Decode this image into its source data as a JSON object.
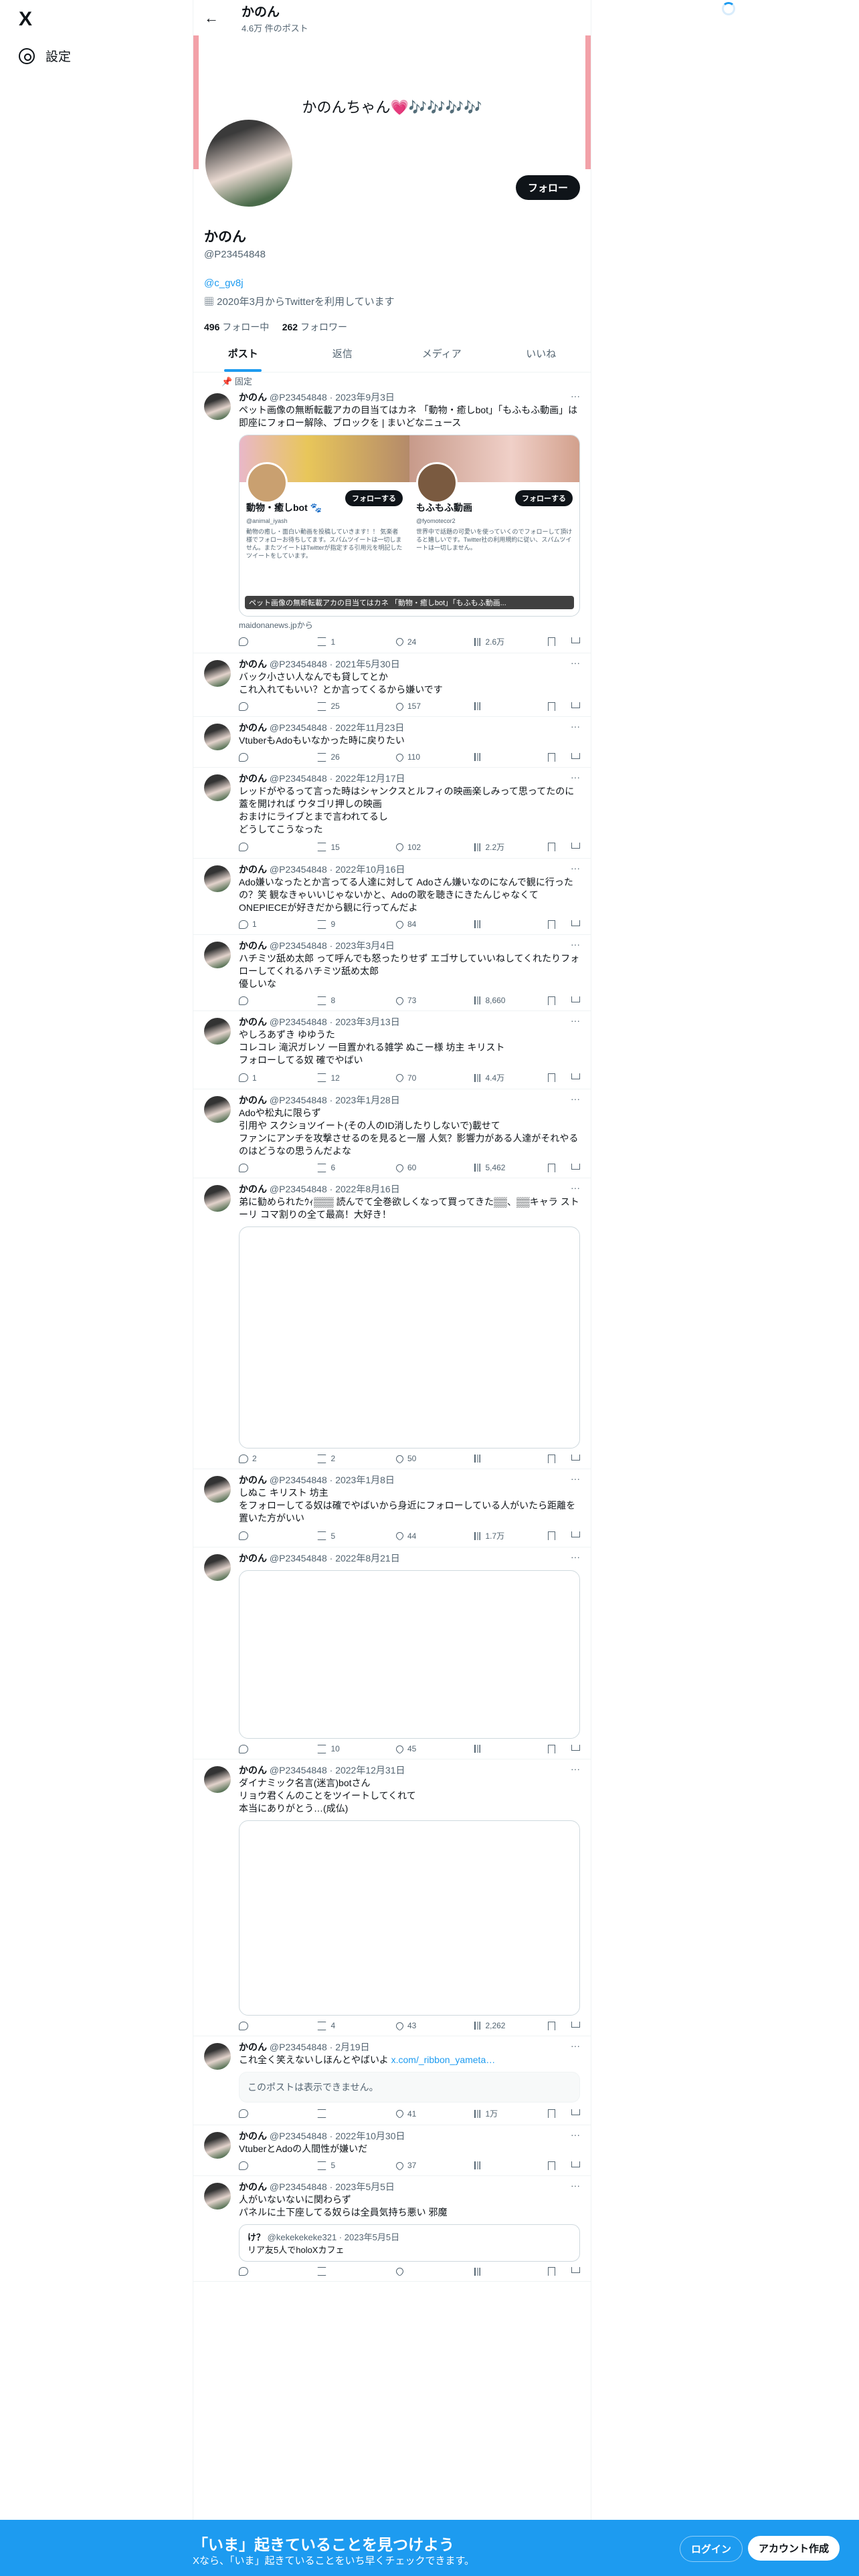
{
  "nav": {
    "logo": "X",
    "settings_label": "設定"
  },
  "header": {
    "name": "かのん",
    "post_count": "4.6万 件のポスト"
  },
  "profile": {
    "banner_text": "かのんちゃん💗🎶🎶🎶🎶",
    "follow_button": "フォロー",
    "name": "かのん",
    "handle": "@P23454848",
    "link": "@c_gv8j",
    "joined": "2020年3月からTwitterを利用しています",
    "following_count": "496",
    "following_label": "フォロー中",
    "followers_count": "262",
    "followers_label": "フォロワー"
  },
  "tabs": [
    "ポスト",
    "返信",
    "メディア",
    "いいね"
  ],
  "pinned_label": "固定",
  "tweets": [
    {
      "name": "かのん",
      "handle": "@P23454848",
      "date": "2023年9月3日",
      "text": "ペット画像の無断転載アカの目当てはカネ 「動物・癒しbot」「もふもふ動画」は即座にフォロー解除、ブロックを | まいどなニュース",
      "card": {
        "left_name": "動物・癒しbot 🐾",
        "left_handle": "@animal_iyash",
        "left_desc": "動物の癒し・面白い動画を投稿していきます！！ 気楽者様でフォローお待ちしてます。スパムツイートは一切しません。またツイートはTwitterが指定する引用元を明記したツイートをしています。",
        "right_name": "もふもふ動画",
        "right_handle": "@fyomotecor2",
        "right_desc": "世界中で話題の可愛いを使っていくのでフォローして頂けると嬉しいです。Twitter社の利用規約に従い、スパムツイートは一切しません。",
        "follow": "フォローする",
        "caption": "ペット画像の無断転載アカの目当てはカネ 「動物・癒しbot」「もふもふ動画...",
        "source": "maidonanews.jpから"
      },
      "reply": "",
      "rt": "1",
      "like": "24",
      "views": "2.6万"
    },
    {
      "name": "かのん",
      "handle": "@P23454848",
      "date": "2021年5月30日",
      "text": "バック小さい人なんでも貸してとか\nこれ入れてもいい？とか言ってくるから嫌いです",
      "reply": "",
      "rt": "25",
      "like": "157",
      "views": ""
    },
    {
      "name": "かのん",
      "handle": "@P23454848",
      "date": "2022年11月23日",
      "text": "VtuberもAdoもいなかった時に戻りたい",
      "reply": "",
      "rt": "26",
      "like": "110",
      "views": ""
    },
    {
      "name": "かのん",
      "handle": "@P23454848",
      "date": "2022年12月17日",
      "text": "レッドがやるって言った時はシャンクスとルフィの映画楽しみって思ってたのに\n蓋を開ければ ウタゴリ押しの映画\nおまけにライブとまで言われてるし\nどうしてこうなった",
      "reply": "",
      "rt": "15",
      "like": "102",
      "views": "2.2万"
    },
    {
      "name": "かのん",
      "handle": "@P23454848",
      "date": "2022年10月16日",
      "text": "Ado嫌いなったとか言ってる人達に対して Adoさん嫌いなのになんで観に行ったの？笑 観なきゃいいじゃないかと、Adoの歌を聴きにきたんじゃなくてONEPIECEが好きだから観に行ってんだよ",
      "reply": "1",
      "rt": "9",
      "like": "84",
      "views": ""
    },
    {
      "name": "かのん",
      "handle": "@P23454848",
      "date": "2023年3月4日",
      "text": "ハチミツ舐め太郎 って呼んでも怒ったりせず エゴサしていいねしてくれたりフォローしてくれるハチミツ舐め太郎\n優しいな",
      "reply": "",
      "rt": "8",
      "like": "73",
      "views": "8,660"
    },
    {
      "name": "かのん",
      "handle": "@P23454848",
      "date": "2023年3月13日",
      "text": "やしろあずき ゆゆうた\nコレコレ 滝沢ガレソ 一目置かれる雑学 ぬこー様 坊主 キリスト\nフォローしてる奴 確でやばい",
      "reply": "1",
      "rt": "12",
      "like": "70",
      "views": "4.4万"
    },
    {
      "name": "かのん",
      "handle": "@P23454848",
      "date": "2023年1月28日",
      "text": "Adoや松丸に限らず\n引用や スクショツイート(その人のID消したりしないで)載せて\nファンにアンチを攻撃させるのを見ると一層 人気？影響力がある人達がそれやるのはどうなの思うんだよな",
      "reply": "",
      "rt": "6",
      "like": "60",
      "views": "5,462"
    },
    {
      "name": "かのん",
      "handle": "@P23454848",
      "date": "2022年8月16日",
      "text": "弟に勧められたｳｨ▒▒▒ 読んでて全巻欲しくなって買ってきた▒▒、▒▒キャラ ストーリ コマ割りの全て最高！大好き！",
      "media": 330,
      "reply": "2",
      "rt": "2",
      "like": "50",
      "views": ""
    },
    {
      "name": "かのん",
      "handle": "@P23454848",
      "date": "2023年1月8日",
      "text": "しぬこ キリスト 坊主\nをフォローしてる奴は確でやばいから身近にフォローしている人がいたら距離を置いた方がいい",
      "reply": "",
      "rt": "5",
      "like": "44",
      "views": "1.7万"
    },
    {
      "name": "かのん",
      "handle": "@P23454848",
      "date": "2022年8月21日",
      "text": "",
      "media": 250,
      "reply": "",
      "rt": "10",
      "like": "45",
      "views": ""
    },
    {
      "name": "かのん",
      "handle": "@P23454848",
      "date": "2022年12月31日",
      "text": "ダイナミック名言(迷言)botさん\nリョウ君くんのことをツイートしてくれて\n本当にありがとう…(成仏)",
      "media": 290,
      "reply": "",
      "rt": "4",
      "like": "43",
      "views": "2,262"
    },
    {
      "name": "かのん",
      "handle": "@P23454848",
      "date": "2月19日",
      "text": "これ全く笑えないしほんとやばいよ ",
      "link": "x.com/_ribbon_yameta…",
      "quote_na": "このポストは表示できません。",
      "reply": "",
      "rt": "",
      "like": "41",
      "views": "1万"
    },
    {
      "name": "かのん",
      "handle": "@P23454848",
      "date": "2022年10月30日",
      "text": "VtuberとAdoの人間性が嫌いだ",
      "reply": "",
      "rt": "5",
      "like": "37",
      "views": ""
    },
    {
      "name": "かのん",
      "handle": "@P23454848",
      "date": "2023年5月5日",
      "text": "人がいないないに関わらず\nパネルに土下座してる奴らは全員気持ち悪い 邪魔",
      "quote": {
        "name": "け？",
        "handle": "@kekekekeke321",
        "date": "2023年5月5日",
        "text": "リア友5人でholoXカフェ"
      },
      "reply": "",
      "rt": "",
      "like": "",
      "views": ""
    }
  ],
  "bottom_bar": {
    "title": "「いま」起きていることを見つけよう",
    "subtitle": "Xなら、「いま」起きていることをいち早くチェックできます。",
    "login": "ログイン",
    "signup": "アカウント作成"
  }
}
